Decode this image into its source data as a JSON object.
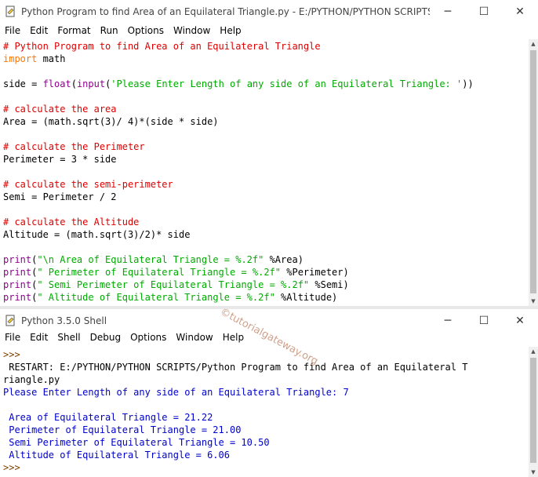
{
  "editor_window": {
    "title": "Python Program to find Area of an Equilateral Triangle.py - E:/PYTHON/PYTHON SCRIPTS/Pytho...",
    "menu": [
      "File",
      "Edit",
      "Format",
      "Run",
      "Options",
      "Window",
      "Help"
    ],
    "code": [
      [
        {
          "t": "cm",
          "v": "# Python Program to find Area of an Equilateral Triangle"
        }
      ],
      [
        {
          "t": "kw",
          "v": "import"
        },
        {
          "t": "df",
          "v": " math"
        }
      ],
      [
        {
          "t": "df",
          "v": ""
        }
      ],
      [
        {
          "t": "df",
          "v": "side = "
        },
        {
          "t": "bi",
          "v": "float"
        },
        {
          "t": "df",
          "v": "("
        },
        {
          "t": "bi",
          "v": "input"
        },
        {
          "t": "df",
          "v": "("
        },
        {
          "t": "st",
          "v": "'Please Enter Length of any side of an Equilateral Triangle: '"
        },
        {
          "t": "df",
          "v": "))"
        }
      ],
      [
        {
          "t": "df",
          "v": ""
        }
      ],
      [
        {
          "t": "cm",
          "v": "# calculate the area"
        }
      ],
      [
        {
          "t": "df",
          "v": "Area = (math.sqrt(3)/ 4)*(side * side)"
        }
      ],
      [
        {
          "t": "df",
          "v": ""
        }
      ],
      [
        {
          "t": "cm",
          "v": "# calculate the Perimeter"
        }
      ],
      [
        {
          "t": "df",
          "v": "Perimeter = 3 * side"
        }
      ],
      [
        {
          "t": "df",
          "v": ""
        }
      ],
      [
        {
          "t": "cm",
          "v": "# calculate the semi-perimeter"
        }
      ],
      [
        {
          "t": "df",
          "v": "Semi = Perimeter / 2"
        }
      ],
      [
        {
          "t": "df",
          "v": ""
        }
      ],
      [
        {
          "t": "cm",
          "v": "# calculate the Altitude"
        }
      ],
      [
        {
          "t": "df",
          "v": "Altitude = (math.sqrt(3)/2)* side"
        }
      ],
      [
        {
          "t": "df",
          "v": ""
        }
      ],
      [
        {
          "t": "bi",
          "v": "print"
        },
        {
          "t": "df",
          "v": "("
        },
        {
          "t": "st",
          "v": "\"\\n Area of Equilateral Triangle = %.2f\""
        },
        {
          "t": "df",
          "v": " %Area)"
        }
      ],
      [
        {
          "t": "bi",
          "v": "print"
        },
        {
          "t": "df",
          "v": "("
        },
        {
          "t": "st",
          "v": "\" Perimeter of Equilateral Triangle = %.2f\""
        },
        {
          "t": "df",
          "v": " %Perimeter)"
        }
      ],
      [
        {
          "t": "bi",
          "v": "print"
        },
        {
          "t": "df",
          "v": "("
        },
        {
          "t": "st",
          "v": "\" Semi Perimeter of Equilateral Triangle = %.2f\""
        },
        {
          "t": "df",
          "v": " %Semi)"
        }
      ],
      [
        {
          "t": "bi",
          "v": "print"
        },
        {
          "t": "df",
          "v": "("
        },
        {
          "t": "st",
          "v": "\" Altitude of Equilateral Triangle = %.2f\""
        },
        {
          "t": "df",
          "v": " %Altitude)"
        }
      ]
    ]
  },
  "shell_window": {
    "title": "Python 3.5.0 Shell",
    "menu": [
      "File",
      "Edit",
      "Shell",
      "Debug",
      "Options",
      "Window",
      "Help"
    ],
    "lines": [
      {
        "t": "prompt",
        "v": ">>>"
      },
      {
        "t": "df",
        "v": " RESTART: E:/PYTHON/PYTHON SCRIPTS/Python Program to find Area of an Equilateral T"
      },
      {
        "t": "df",
        "v": "riangle.py"
      },
      {
        "t": "out",
        "v": "Please Enter Length of any side of an Equilateral Triangle: 7"
      },
      {
        "t": "df",
        "v": ""
      },
      {
        "t": "out",
        "v": " Area of Equilateral Triangle = 21.22"
      },
      {
        "t": "out",
        "v": " Perimeter of Equilateral Triangle = 21.00"
      },
      {
        "t": "out",
        "v": " Semi Perimeter of Equilateral Triangle = 10.50"
      },
      {
        "t": "out",
        "v": " Altitude of Equilateral Triangle = 6.06"
      },
      {
        "t": "prompt",
        "v": ">>>"
      }
    ]
  },
  "watermark": "©tutorialgateway.org",
  "window_controls": {
    "minimize": "─",
    "maximize": "☐",
    "close": "✕"
  }
}
